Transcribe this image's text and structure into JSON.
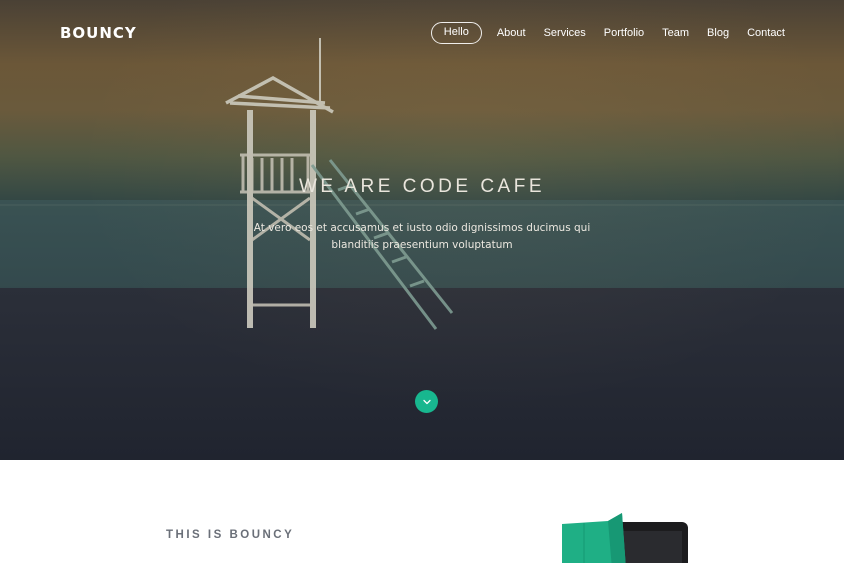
{
  "brand": {
    "name": "BOUNCY"
  },
  "nav": {
    "items": [
      {
        "label": "Hello",
        "active": true
      },
      {
        "label": "About",
        "active": false
      },
      {
        "label": "Services",
        "active": false
      },
      {
        "label": "Portfolio",
        "active": false
      },
      {
        "label": "Team",
        "active": false
      },
      {
        "label": "Blog",
        "active": false
      },
      {
        "label": "Contact",
        "active": false
      }
    ]
  },
  "hero": {
    "title": "WE ARE CODE CAFE",
    "subtitle": "At vero eos et accusamus et iusto odio dignissimos ducimus qui blanditiis praesentium voluptatum",
    "scroll_icon": "chevron-down-icon"
  },
  "about": {
    "title": "THIS IS BOUNCY"
  },
  "colors": {
    "accent": "#18b78f",
    "text_light": "#ffffff",
    "section_title": "#6a6f78"
  }
}
